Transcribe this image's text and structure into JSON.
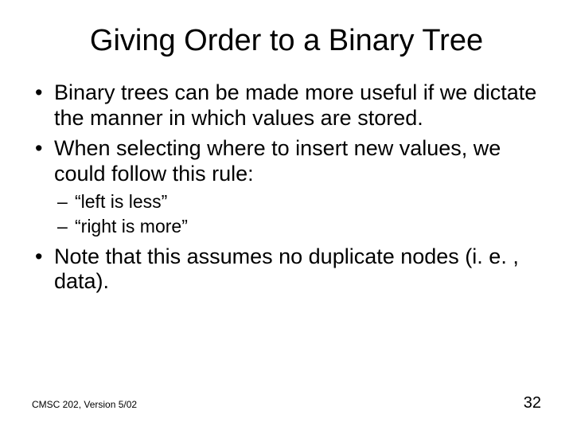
{
  "title": "Giving Order to a Binary Tree",
  "bullets": {
    "b1": "Binary trees can be made more useful if we dictate the manner in which values are stored.",
    "b2": "When selecting where to insert new values, we could follow this rule:",
    "sub1": "“left is less”",
    "sub2": "“right is more”",
    "b3": "Note that this assumes no duplicate nodes (i. e. , data)."
  },
  "footer": {
    "left": "CMSC 202, Version 5/02",
    "right": "32"
  }
}
